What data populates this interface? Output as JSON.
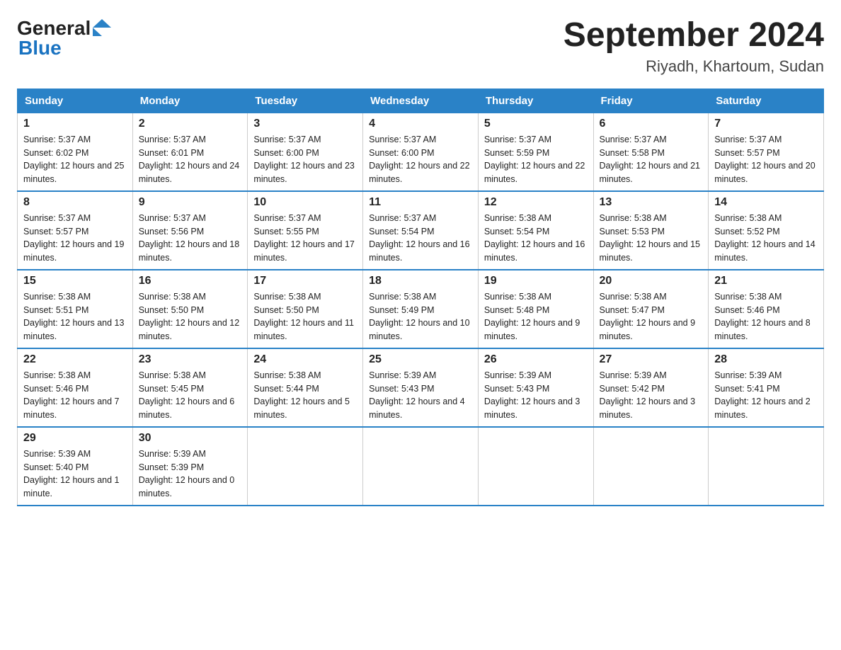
{
  "logo": {
    "general": "General",
    "blue": "Blue"
  },
  "title": "September 2024",
  "subtitle": "Riyadh, Khartoum, Sudan",
  "headers": [
    "Sunday",
    "Monday",
    "Tuesday",
    "Wednesday",
    "Thursday",
    "Friday",
    "Saturday"
  ],
  "weeks": [
    [
      {
        "day": "1",
        "sunrise": "Sunrise: 5:37 AM",
        "sunset": "Sunset: 6:02 PM",
        "daylight": "Daylight: 12 hours and 25 minutes."
      },
      {
        "day": "2",
        "sunrise": "Sunrise: 5:37 AM",
        "sunset": "Sunset: 6:01 PM",
        "daylight": "Daylight: 12 hours and 24 minutes."
      },
      {
        "day": "3",
        "sunrise": "Sunrise: 5:37 AM",
        "sunset": "Sunset: 6:00 PM",
        "daylight": "Daylight: 12 hours and 23 minutes."
      },
      {
        "day": "4",
        "sunrise": "Sunrise: 5:37 AM",
        "sunset": "Sunset: 6:00 PM",
        "daylight": "Daylight: 12 hours and 22 minutes."
      },
      {
        "day": "5",
        "sunrise": "Sunrise: 5:37 AM",
        "sunset": "Sunset: 5:59 PM",
        "daylight": "Daylight: 12 hours and 22 minutes."
      },
      {
        "day": "6",
        "sunrise": "Sunrise: 5:37 AM",
        "sunset": "Sunset: 5:58 PM",
        "daylight": "Daylight: 12 hours and 21 minutes."
      },
      {
        "day": "7",
        "sunrise": "Sunrise: 5:37 AM",
        "sunset": "Sunset: 5:57 PM",
        "daylight": "Daylight: 12 hours and 20 minutes."
      }
    ],
    [
      {
        "day": "8",
        "sunrise": "Sunrise: 5:37 AM",
        "sunset": "Sunset: 5:57 PM",
        "daylight": "Daylight: 12 hours and 19 minutes."
      },
      {
        "day": "9",
        "sunrise": "Sunrise: 5:37 AM",
        "sunset": "Sunset: 5:56 PM",
        "daylight": "Daylight: 12 hours and 18 minutes."
      },
      {
        "day": "10",
        "sunrise": "Sunrise: 5:37 AM",
        "sunset": "Sunset: 5:55 PM",
        "daylight": "Daylight: 12 hours and 17 minutes."
      },
      {
        "day": "11",
        "sunrise": "Sunrise: 5:37 AM",
        "sunset": "Sunset: 5:54 PM",
        "daylight": "Daylight: 12 hours and 16 minutes."
      },
      {
        "day": "12",
        "sunrise": "Sunrise: 5:38 AM",
        "sunset": "Sunset: 5:54 PM",
        "daylight": "Daylight: 12 hours and 16 minutes."
      },
      {
        "day": "13",
        "sunrise": "Sunrise: 5:38 AM",
        "sunset": "Sunset: 5:53 PM",
        "daylight": "Daylight: 12 hours and 15 minutes."
      },
      {
        "day": "14",
        "sunrise": "Sunrise: 5:38 AM",
        "sunset": "Sunset: 5:52 PM",
        "daylight": "Daylight: 12 hours and 14 minutes."
      }
    ],
    [
      {
        "day": "15",
        "sunrise": "Sunrise: 5:38 AM",
        "sunset": "Sunset: 5:51 PM",
        "daylight": "Daylight: 12 hours and 13 minutes."
      },
      {
        "day": "16",
        "sunrise": "Sunrise: 5:38 AM",
        "sunset": "Sunset: 5:50 PM",
        "daylight": "Daylight: 12 hours and 12 minutes."
      },
      {
        "day": "17",
        "sunrise": "Sunrise: 5:38 AM",
        "sunset": "Sunset: 5:50 PM",
        "daylight": "Daylight: 12 hours and 11 minutes."
      },
      {
        "day": "18",
        "sunrise": "Sunrise: 5:38 AM",
        "sunset": "Sunset: 5:49 PM",
        "daylight": "Daylight: 12 hours and 10 minutes."
      },
      {
        "day": "19",
        "sunrise": "Sunrise: 5:38 AM",
        "sunset": "Sunset: 5:48 PM",
        "daylight": "Daylight: 12 hours and 9 minutes."
      },
      {
        "day": "20",
        "sunrise": "Sunrise: 5:38 AM",
        "sunset": "Sunset: 5:47 PM",
        "daylight": "Daylight: 12 hours and 9 minutes."
      },
      {
        "day": "21",
        "sunrise": "Sunrise: 5:38 AM",
        "sunset": "Sunset: 5:46 PM",
        "daylight": "Daylight: 12 hours and 8 minutes."
      }
    ],
    [
      {
        "day": "22",
        "sunrise": "Sunrise: 5:38 AM",
        "sunset": "Sunset: 5:46 PM",
        "daylight": "Daylight: 12 hours and 7 minutes."
      },
      {
        "day": "23",
        "sunrise": "Sunrise: 5:38 AM",
        "sunset": "Sunset: 5:45 PM",
        "daylight": "Daylight: 12 hours and 6 minutes."
      },
      {
        "day": "24",
        "sunrise": "Sunrise: 5:38 AM",
        "sunset": "Sunset: 5:44 PM",
        "daylight": "Daylight: 12 hours and 5 minutes."
      },
      {
        "day": "25",
        "sunrise": "Sunrise: 5:39 AM",
        "sunset": "Sunset: 5:43 PM",
        "daylight": "Daylight: 12 hours and 4 minutes."
      },
      {
        "day": "26",
        "sunrise": "Sunrise: 5:39 AM",
        "sunset": "Sunset: 5:43 PM",
        "daylight": "Daylight: 12 hours and 3 minutes."
      },
      {
        "day": "27",
        "sunrise": "Sunrise: 5:39 AM",
        "sunset": "Sunset: 5:42 PM",
        "daylight": "Daylight: 12 hours and 3 minutes."
      },
      {
        "day": "28",
        "sunrise": "Sunrise: 5:39 AM",
        "sunset": "Sunset: 5:41 PM",
        "daylight": "Daylight: 12 hours and 2 minutes."
      }
    ],
    [
      {
        "day": "29",
        "sunrise": "Sunrise: 5:39 AM",
        "sunset": "Sunset: 5:40 PM",
        "daylight": "Daylight: 12 hours and 1 minute."
      },
      {
        "day": "30",
        "sunrise": "Sunrise: 5:39 AM",
        "sunset": "Sunset: 5:39 PM",
        "daylight": "Daylight: 12 hours and 0 minutes."
      },
      null,
      null,
      null,
      null,
      null
    ]
  ]
}
